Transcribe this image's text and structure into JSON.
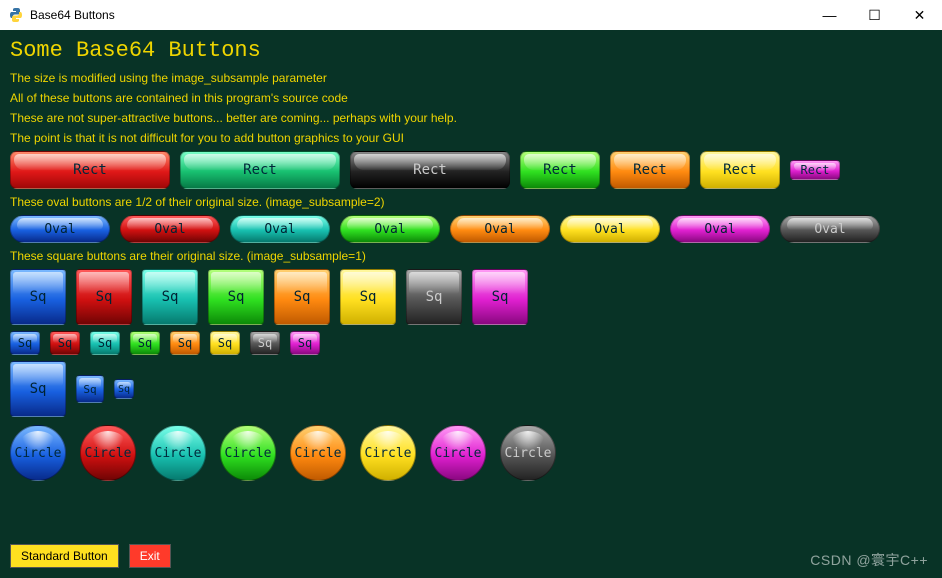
{
  "window": {
    "title": "Base64 Buttons",
    "icon": "python-icon",
    "controls": {
      "minimize": "—",
      "maximize": "☐",
      "close": "✕"
    }
  },
  "heading": "Some Base64 Buttons",
  "descriptions": [
    "The size is modified using the image_subsample parameter",
    "All of these buttons are contained in this program's source code",
    "These are not super-attractive buttons... better are coming... perhaps with your help.",
    "The point is that it is not difficult for you to add button graphics to your GUI"
  ],
  "rect_row": [
    {
      "label": "Rect",
      "color": "c-red",
      "size": "w-lg"
    },
    {
      "label": "Rect",
      "color": "c-green",
      "size": "w-lg"
    },
    {
      "label": "Rect",
      "color": "c-black",
      "size": "w-lg"
    },
    {
      "label": "Rect",
      "color": "c-brightgreen",
      "size": "w-md"
    },
    {
      "label": "Rect",
      "color": "c-orange",
      "size": "w-md"
    },
    {
      "label": "Rect",
      "color": "c-yellow",
      "size": "w-md"
    },
    {
      "label": "Rect",
      "color": "c-magenta",
      "size": "w-sm"
    }
  ],
  "oval_caption": "These oval buttons are 1/2 of their original size. (image_subsample=2)",
  "oval_row": [
    {
      "label": "Oval",
      "color": "c-blue"
    },
    {
      "label": "Oval",
      "color": "c-darkred"
    },
    {
      "label": "Oval",
      "color": "c-teal"
    },
    {
      "label": "Oval",
      "color": "c-brightgreen"
    },
    {
      "label": "Oval",
      "color": "c-orange"
    },
    {
      "label": "Oval",
      "color": "c-yellow"
    },
    {
      "label": "Oval",
      "color": "c-magenta"
    },
    {
      "label": "Oval",
      "color": "c-gray"
    }
  ],
  "square_caption": "These square buttons are their original size. (image_subsample=1)",
  "square_row1": [
    {
      "label": "Sq",
      "color": "c-blue"
    },
    {
      "label": "Sq",
      "color": "c-darkred"
    },
    {
      "label": "Sq",
      "color": "c-teal"
    },
    {
      "label": "Sq",
      "color": "c-brightgreen"
    },
    {
      "label": "Sq",
      "color": "c-orange"
    },
    {
      "label": "Sq",
      "color": "c-yellow"
    },
    {
      "label": "Sq",
      "color": "c-gray"
    },
    {
      "label": "Sq",
      "color": "c-magenta"
    }
  ],
  "square_row2": [
    {
      "label": "Sq",
      "color": "c-blue"
    },
    {
      "label": "Sq",
      "color": "c-darkred"
    },
    {
      "label": "Sq",
      "color": "c-teal"
    },
    {
      "label": "Sq",
      "color": "c-brightgreen"
    },
    {
      "label": "Sq",
      "color": "c-orange"
    },
    {
      "label": "Sq",
      "color": "c-yellow"
    },
    {
      "label": "Sq",
      "color": "c-gray"
    },
    {
      "label": "Sq",
      "color": "c-magenta"
    }
  ],
  "square_row3": [
    {
      "label": "Sq",
      "color": "c-blue",
      "size": "sq-sm1"
    },
    {
      "label": "Sq",
      "color": "c-blue",
      "size": "sq-sm2"
    },
    {
      "label": "Sq",
      "color": "c-blue",
      "size": "sq-sm3"
    }
  ],
  "circle_row": [
    {
      "label": "Circle",
      "color": "c-blue"
    },
    {
      "label": "Circle",
      "color": "c-darkred"
    },
    {
      "label": "Circle",
      "color": "c-teal"
    },
    {
      "label": "Circle",
      "color": "c-brightgreen"
    },
    {
      "label": "Circle",
      "color": "c-orange"
    },
    {
      "label": "Circle",
      "color": "c-yellow"
    },
    {
      "label": "Circle",
      "color": "c-magenta"
    },
    {
      "label": "Circle",
      "color": "c-gray"
    }
  ],
  "bottom_buttons": {
    "standard": "Standard Button",
    "exit": "Exit"
  },
  "watermark": "CSDN @寰宇C++"
}
